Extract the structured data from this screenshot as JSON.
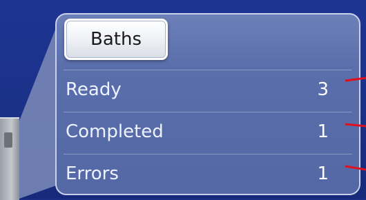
{
  "panel": {
    "header_button": {
      "label": "Baths"
    },
    "rows": [
      {
        "label": "Ready",
        "value": "3"
      },
      {
        "label": "Completed",
        "value": "1"
      },
      {
        "label": "Errors",
        "value": "1"
      }
    ]
  },
  "colors": {
    "background": "#1a2f84",
    "panel": "#5a6eab",
    "pointer_line": "#e0101e"
  }
}
